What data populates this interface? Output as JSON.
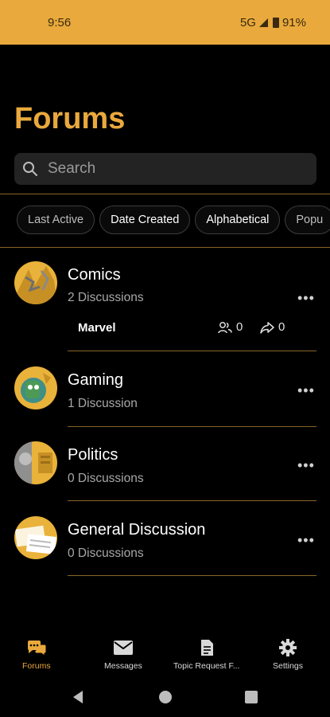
{
  "status": {
    "time": "9:56",
    "network": "5G",
    "battery": "91%"
  },
  "header": {
    "title": "Forums"
  },
  "search": {
    "placeholder": "Search"
  },
  "sort_chips": [
    "Last Active",
    "Date Created",
    "Alphabetical",
    "Popu"
  ],
  "forums": [
    {
      "name": "Comics",
      "discussions": "2 Discussions",
      "sub_item": {
        "name": "Marvel",
        "members": "0",
        "shares": "0"
      }
    },
    {
      "name": "Gaming",
      "discussions": "1 Discussion"
    },
    {
      "name": "Politics",
      "discussions": "0 Discussions"
    },
    {
      "name": "General Discussion",
      "discussions": "0 Discussions"
    }
  ],
  "bottom_nav": {
    "forums": "Forums",
    "messages": "Messages",
    "topic_request": "Topic Request F...",
    "settings": "Settings"
  },
  "colors": {
    "accent": "#E9A93C",
    "background": "#000000",
    "surface": "#232323"
  }
}
